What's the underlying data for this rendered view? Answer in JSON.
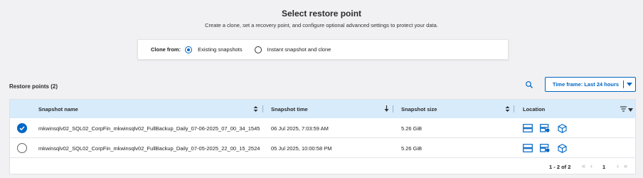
{
  "header": {
    "title": "Select restore point",
    "subtitle": "Create a clone, set a recovery point, and configure optional advanced settings to protect your data."
  },
  "clone_from": {
    "label": "Clone from:",
    "options": [
      {
        "label": "Existing snapshots",
        "selected": true
      },
      {
        "label": "Instant snapshot and clone",
        "selected": false
      }
    ]
  },
  "restore_points": {
    "heading": "Restore points (2)",
    "timeframe_label": "Time frame: Last 24 hours",
    "columns": {
      "name": "Snapshot name",
      "time": "Snapshot time",
      "size": "Snapshot size",
      "location": "Location"
    },
    "rows": [
      {
        "selected": true,
        "name": "mkwinsqlv02_SQL02_CorpFin_mkwinsqlv02_FullBackup_Daily_07-06-2025_07_00_34_1545",
        "time": "06 Jul 2025, 7:03:59 AM",
        "size": "5.26 GiB",
        "location_icons": [
          "storage-icon",
          "cloud-storage-icon",
          "object-store-icon"
        ]
      },
      {
        "selected": false,
        "name": "mkwinsqlv02_SQL02_CorpFin_mkwinsqlv02_FullBackup_Daily_07-05-2025_22_00_15_2524",
        "time": "05 Jul 2025, 10:00:58 PM",
        "size": "5.26 GiB",
        "location_icons": [
          "storage-icon",
          "cloud-storage-icon",
          "object-store-icon"
        ]
      }
    ],
    "pagination": {
      "range": "1 - 2 of 2",
      "page": "1"
    }
  },
  "colors": {
    "accent": "#0067c5",
    "header_bg": "#d7ebfb",
    "page_bg": "#f1f1f3"
  }
}
